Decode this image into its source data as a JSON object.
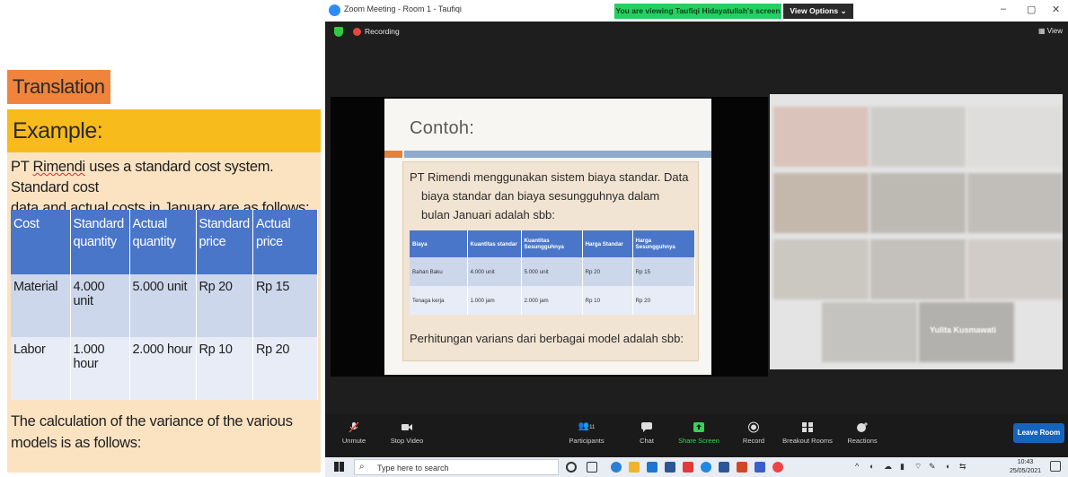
{
  "translation_panel": {
    "label": "Translation",
    "example_heading": "Example:",
    "intro_line1_pre": "PT ",
    "intro_company": "Rimendi",
    "intro_line1_post": " uses a standard cost system. Standard cost",
    "intro_line2": "data and actual costs in January are as follows:",
    "table": {
      "headers": [
        "Cost",
        "Standard quantity",
        "Actual quantity",
        "Standard price",
        "Actual price"
      ],
      "rows": [
        [
          "Material",
          "4.000 unit",
          "5.000 unit",
          "Rp 20",
          "Rp 15"
        ],
        [
          "Labor",
          "1.000 hour",
          "2.000 hour",
          "Rp 10",
          "Rp 20"
        ]
      ]
    },
    "footer": "The calculation of the variance of the various models is as follows:"
  },
  "zoom": {
    "window_title": "Zoom Meeting - Room 1 - Taufiqi",
    "viewing_banner": "You are viewing Taufiqi Hidayatullah's screen",
    "view_options": "View Options",
    "window_controls": [
      "–",
      "▢",
      "✕"
    ],
    "recording_label": "Recording",
    "view_button": "View",
    "slide": {
      "title": "Contoh:",
      "intro_lines": [
        "PT Rimendi menggunakan sistem biaya standar. Data",
        "biaya standar dan biaya sesungguhnya dalam",
        "bulan Januari adalah sbb:"
      ],
      "table": {
        "headers": [
          "Biaya",
          "Kuantitas standar",
          "Kuantitas Sesungguhnya",
          "Harga Standar",
          "Harga Sesungguhnya"
        ],
        "rows": [
          [
            "Bahan Baku",
            "4.000 unit",
            "5.000 unit",
            "Rp 20",
            "Rp 15"
          ],
          [
            "Tenaga kerja",
            "1.000 jam",
            "2.000 jam",
            "Rp 10",
            "Rp 20"
          ]
        ]
      },
      "footer": "Perhitungan varians dari berbagai model adalah sbb:"
    },
    "gallery_name": "Yulita Kusmawati",
    "toolbar": {
      "unmute": "Unmute",
      "stop_video": "Stop Video",
      "participants": "Participants",
      "participants_count": "11",
      "chat": "Chat",
      "share_screen": "Share Screen",
      "record": "Record",
      "breakout_rooms": "Breakout Rooms",
      "reactions": "Reactions",
      "leave_room": "Leave Room"
    }
  },
  "taskbar": {
    "search_placeholder": "Type here to search",
    "time": "10:43",
    "date": "25/05/2021"
  },
  "colors": {
    "translation_label_bg": "#f0843c",
    "example_heading_bg": "#f8bb1c",
    "example_body_bg": "#fbe3c2",
    "table_header_bg": "#4a76c9",
    "zoom_green": "#23d160",
    "leave_button": "#1565c0"
  }
}
